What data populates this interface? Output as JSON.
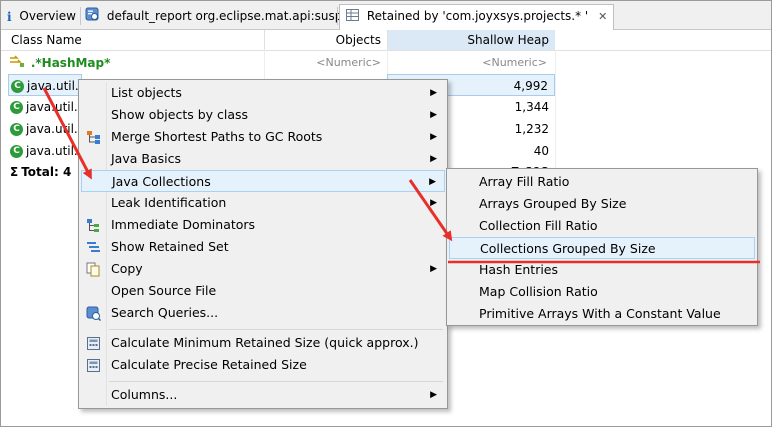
{
  "tabs": [
    {
      "label": "Overview"
    },
    {
      "label": "default_report  org.eclipse.mat.api:suspects"
    },
    {
      "label": "Retained by 'com.joyxsys.projects.* '"
    }
  ],
  "table": {
    "columns": [
      "Class Name",
      "Objects",
      "Shallow Heap"
    ],
    "filter_row": {
      "name": ".*HashMap*",
      "objects_placeholder": "<Numeric>",
      "heap_placeholder": "<Numeric>"
    },
    "rows": [
      {
        "name": "java.util.H",
        "heap": "4,992"
      },
      {
        "name": "java.util.c",
        "heap": "1,344"
      },
      {
        "name": "java.util.L",
        "heap": "1,232"
      },
      {
        "name": "java.util.c",
        "heap": "40"
      }
    ],
    "total": {
      "label": "Total: 4",
      "heap": "7,608"
    }
  },
  "context_menu": {
    "items": [
      {
        "label": "List objects"
      },
      {
        "label": "Show objects by class"
      },
      {
        "label": "Merge Shortest Paths to GC Roots"
      },
      {
        "label": "Java Basics"
      },
      {
        "label": "Java Collections"
      },
      {
        "label": "Leak Identification"
      },
      {
        "label": "Immediate Dominators"
      },
      {
        "label": "Show Retained Set"
      },
      {
        "label": "Copy"
      },
      {
        "label": "Open Source File"
      },
      {
        "label": "Search Queries..."
      },
      {
        "label": "Calculate Minimum Retained Size (quick approx.)"
      },
      {
        "label": "Calculate Precise Retained Size"
      },
      {
        "label": "Columns..."
      }
    ]
  },
  "submenu": {
    "items": [
      {
        "label": "Array Fill Ratio"
      },
      {
        "label": "Arrays Grouped By Size"
      },
      {
        "label": "Collection Fill Ratio"
      },
      {
        "label": "Collections Grouped By Size"
      },
      {
        "label": "Hash Entries"
      },
      {
        "label": "Map Collision Ratio"
      },
      {
        "label": "Primitive Arrays With a Constant Value"
      }
    ]
  },
  "colors": {
    "annotation_red": "#e8302a",
    "class_icon_green": "#2e9b3a",
    "highlight_bg": "#e5f1fb",
    "filter_green": "#1e8c1e"
  }
}
